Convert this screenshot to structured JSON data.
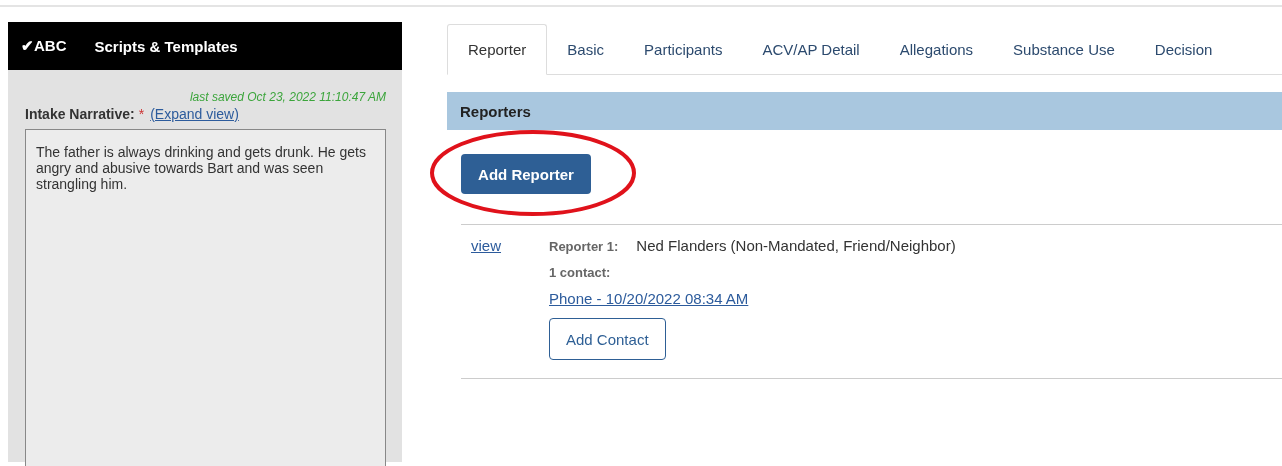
{
  "sidebar": {
    "header": {
      "check": "✔",
      "brand": "ABC",
      "title": "Scripts & Templates"
    },
    "last_saved": "last saved Oct 23, 2022 11:10:47 AM",
    "narrative_label": "Intake Narrative:",
    "required_mark": "*",
    "expand_link": "(Expand view)",
    "narrative": "The father is always drinking and gets drunk. He gets angry and abusive towards Bart and was seen strangling him."
  },
  "tabs": [
    {
      "label": "Reporter",
      "selected": true
    },
    {
      "label": "Basic",
      "selected": false
    },
    {
      "label": "Participants",
      "selected": false
    },
    {
      "label": "ACV/AP Detail",
      "selected": false
    },
    {
      "label": "Allegations",
      "selected": false
    },
    {
      "label": "Substance Use",
      "selected": false
    },
    {
      "label": "Decision",
      "selected": false
    }
  ],
  "section_title": "Reporters",
  "add_reporter_button": "Add Reporter",
  "annotation": {
    "kind": "ellipse"
  },
  "reporters": [
    {
      "view_link": "view",
      "label": "Reporter 1:",
      "name": "Ned Flanders (Non-Mandated, Friend/Neighbor)",
      "contacts_label": "1 contact:",
      "contact_link": "Phone - 10/20/2022 08:34 AM",
      "add_contact_button": "Add Contact"
    }
  ]
}
